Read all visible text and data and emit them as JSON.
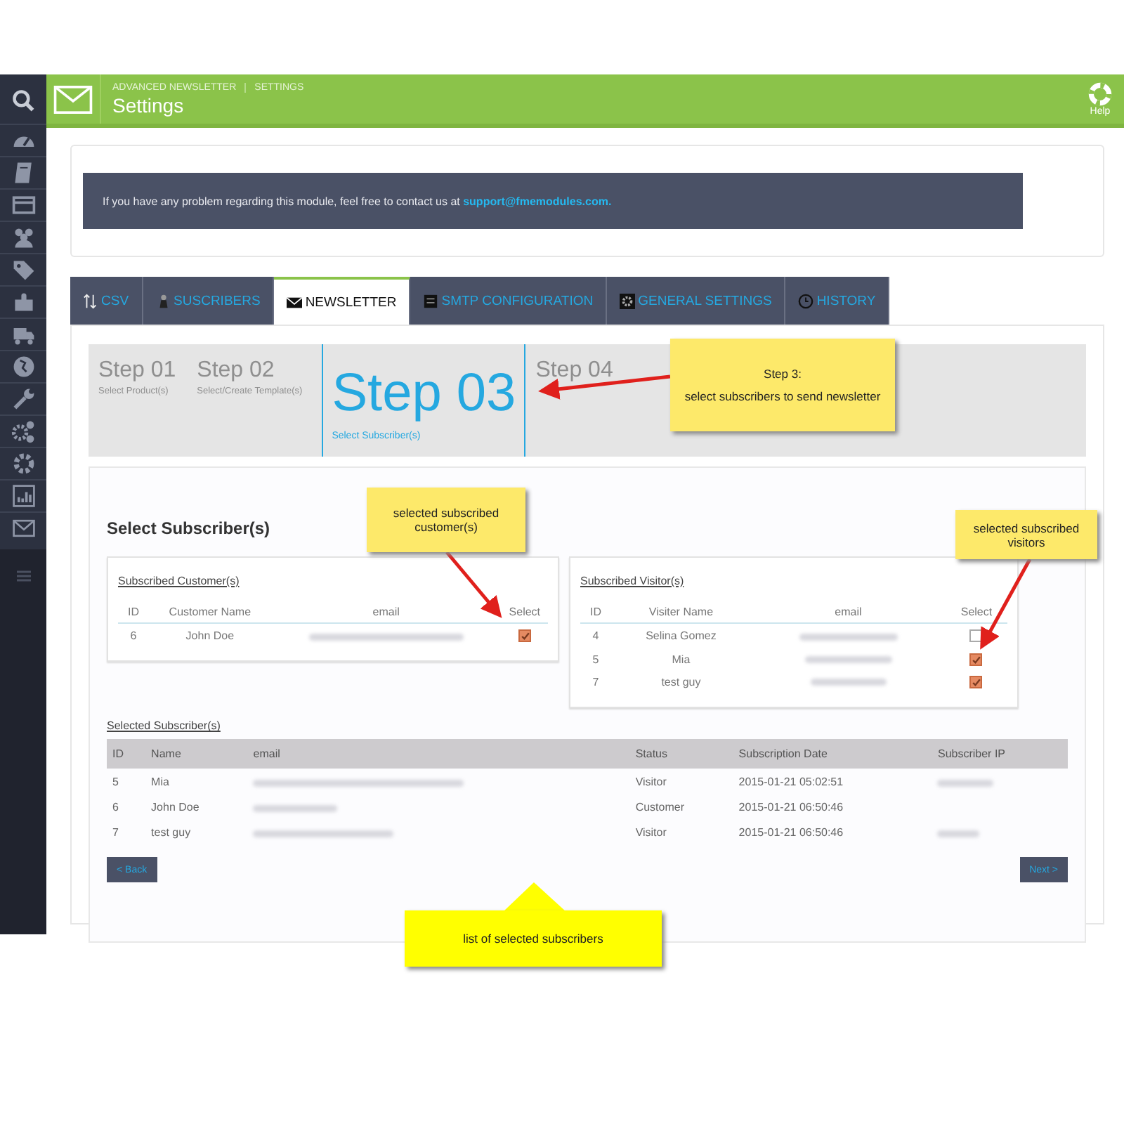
{
  "header": {
    "breadcrumb": [
      "ADVANCED NEWSLETTER",
      "SETTINGS"
    ],
    "title": "Settings",
    "help": "Help"
  },
  "notice": {
    "text": "If you have any problem regarding this module, feel free to contact us at",
    "link": "support@fmemodules.com."
  },
  "tabs": [
    {
      "label": "CSV",
      "kind": "sort",
      "selected": false
    },
    {
      "label": "SUSCRIBERS",
      "kind": "person",
      "selected": false
    },
    {
      "label": "NEWSLETTER",
      "kind": "mail",
      "selected": true
    },
    {
      "label": "SMTP CONFIGURATION",
      "kind": "server",
      "selected": false
    },
    {
      "label": "GENERAL SETTINGS",
      "kind": "gear",
      "selected": false
    },
    {
      "label": "HISTORY",
      "kind": "clock",
      "selected": false
    }
  ],
  "steps": [
    {
      "title": "Step 01",
      "subtitle": "Select Product(s)",
      "selected": false
    },
    {
      "title": "Step 02",
      "subtitle": "Select/Create Template(s)",
      "selected": false
    },
    {
      "title": "Step 03",
      "subtitle": "Select Subscriber(s)",
      "selected": true
    },
    {
      "title": "Step 04",
      "selected": false
    }
  ],
  "section_title": "Select Subscriber(s)",
  "customers": {
    "title": "Subscribed Customer(s)",
    "columns": [
      "ID",
      "Customer Name",
      "email",
      "Select"
    ],
    "rows": [
      {
        "id": "6",
        "name": "John Doe",
        "checked": true
      }
    ]
  },
  "visitors": {
    "title": "Subscribed Visitor(s)",
    "columns": [
      "ID",
      "Visiter Name",
      "email",
      "Select"
    ],
    "rows": [
      {
        "id": "4",
        "name": "Selina Gomez",
        "checked": false
      },
      {
        "id": "5",
        "name": "Mia",
        "checked": true
      },
      {
        "id": "7",
        "name": "test guy",
        "checked": true
      }
    ]
  },
  "selected": {
    "title": "Selected Subscriber(s)",
    "columns": [
      "ID",
      "Name",
      "email",
      "Status",
      "Subscription Date",
      "Subscriber IP"
    ],
    "rows": [
      {
        "id": "5",
        "name": "Mia",
        "status": "Visitor",
        "date": "2015-01-21 05:02:51"
      },
      {
        "id": "6",
        "name": "John Doe",
        "status": "Customer",
        "date": "2015-01-21 06:50:46"
      },
      {
        "id": "7",
        "name": "test guy",
        "status": "Visitor",
        "date": "2015-01-21 06:50:46"
      }
    ]
  },
  "buttons": {
    "back": "< Back",
    "next": "Next >"
  },
  "callouts": [
    {
      "lines": [
        "Step 3:",
        "select subscribers to send newsletter"
      ]
    },
    {
      "lines": [
        "selected subscribed customer(s)"
      ]
    },
    {
      "lines": [
        "selected subscribed visitors"
      ]
    },
    {
      "lines": [
        "list of selected subscribers"
      ]
    }
  ]
}
